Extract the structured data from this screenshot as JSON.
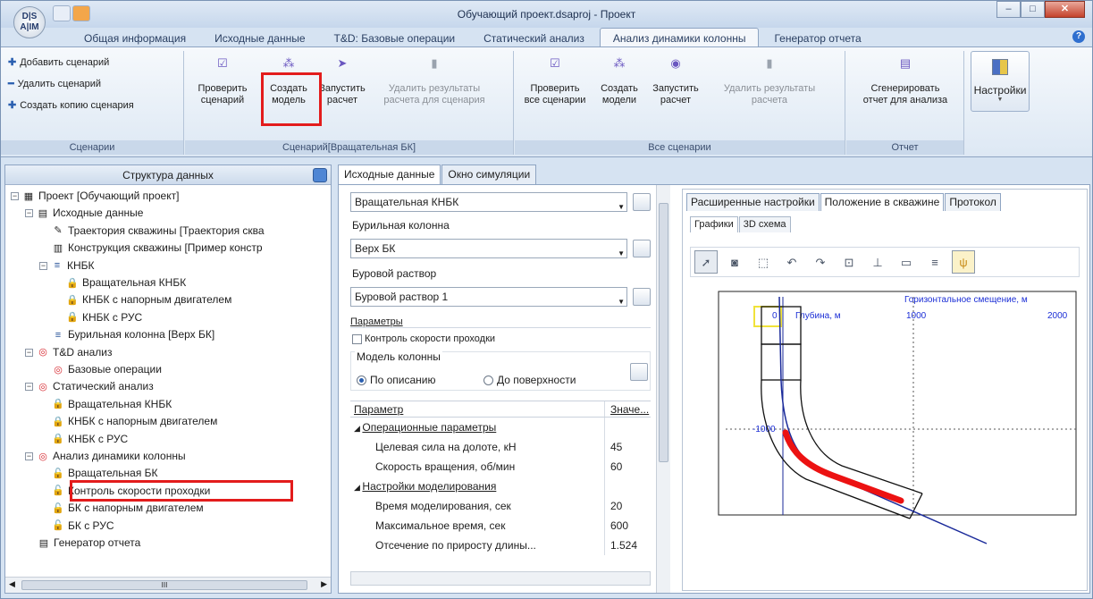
{
  "window": {
    "title": "Обучающий проект.dsaproj - Проект",
    "logo_text": "D|S A|IM"
  },
  "ribbon_tabs": [
    "Общая информация",
    "Исходные данные",
    "T&D: Базовые операции",
    "Статический анализ",
    "Анализ динамики колонны",
    "Генератор отчета"
  ],
  "active_ribbon_tab": 4,
  "ribbon": {
    "scenarios_group": {
      "label": "Сценарии",
      "add": "Добавить сценарий",
      "delete": "Удалить сценарий",
      "copy": "Создать копию сценария"
    },
    "scenario_group": {
      "label": "Сценарий[Вращательная БК]",
      "check": "Проверить сценарий",
      "check_l1": "Проверить",
      "check_l2": "сценарий",
      "create_l1": "Создать",
      "create_l2": "модель",
      "run_l1": "Запустить",
      "run_l2": "расчет",
      "del_l1": "Удалить результаты",
      "del_l2": "расчета для сценария"
    },
    "all_group": {
      "label": "Все сценарии",
      "check_l1": "Проверить",
      "check_l2": "все сценарии",
      "create_l1": "Создать",
      "create_l2": "модели",
      "run_l1": "Запустить",
      "run_l2": "расчет",
      "del_l1": "Удалить результаты",
      "del_l2": "расчета"
    },
    "report_group": {
      "label": "Отчет",
      "gen_l1": "Сгенерировать",
      "gen_l2": "отчет для анализа"
    },
    "settings_label": "Настройки"
  },
  "left_panel": {
    "title": "Структура данных",
    "tree": [
      {
        "label": "Проект [Обучающий проект]",
        "level": 0,
        "icon": "project-icon",
        "exp": "−"
      },
      {
        "label": "Исходные данные",
        "level": 1,
        "icon": "folder-icon",
        "exp": "−"
      },
      {
        "label": "Траектория скважины [Траектория сква",
        "level": 2,
        "icon": "trajectory-icon",
        "exp": ""
      },
      {
        "label": "Конструкция скважины [Пример констр",
        "level": 2,
        "icon": "construction-icon",
        "exp": ""
      },
      {
        "label": "КНБК",
        "level": 2,
        "icon": "bha-icon",
        "exp": "−"
      },
      {
        "label": "Вращательная КНБК",
        "level": 3,
        "icon": "lock-icon",
        "exp": ""
      },
      {
        "label": "КНБК с напорным двигателем",
        "level": 3,
        "icon": "lock-icon",
        "exp": ""
      },
      {
        "label": "КНБК с РУС",
        "level": 3,
        "icon": "lock-icon",
        "exp": ""
      },
      {
        "label": "Бурильная колонна [Верх БК]",
        "level": 2,
        "icon": "drillstring-icon",
        "exp": ""
      },
      {
        "label": "T&D анализ",
        "level": 1,
        "icon": "analysis-icon",
        "exp": "−"
      },
      {
        "label": "Базовые операции",
        "level": 2,
        "icon": "analysis-icon",
        "exp": ""
      },
      {
        "label": "Статический анализ",
        "level": 1,
        "icon": "analysis-icon",
        "exp": "−"
      },
      {
        "label": "Вращательная КНБК",
        "level": 2,
        "icon": "lock-icon",
        "exp": ""
      },
      {
        "label": "КНБК с напорным двигателем",
        "level": 2,
        "icon": "lock-icon",
        "exp": ""
      },
      {
        "label": "КНБК с РУС",
        "level": 2,
        "icon": "lock-icon",
        "exp": ""
      },
      {
        "label": "Анализ динамики колонны",
        "level": 1,
        "icon": "analysis-icon",
        "exp": "−"
      },
      {
        "label": "Вращательная БК",
        "level": 2,
        "icon": "unlock-icon",
        "exp": ""
      },
      {
        "label": "Контроль скорости проходки",
        "level": 2,
        "icon": "unlock-icon",
        "exp": ""
      },
      {
        "label": "БК с напорным двигателем",
        "level": 2,
        "icon": "unlock-icon",
        "exp": ""
      },
      {
        "label": "БК с РУС",
        "level": 2,
        "icon": "unlock-icon",
        "exp": ""
      },
      {
        "label": "Генератор отчета",
        "level": 1,
        "icon": "report-icon",
        "exp": ""
      }
    ]
  },
  "doc_tabs": [
    "Исходные данные",
    "Окно симуляции"
  ],
  "form": {
    "bha_value": "Вращательная КНБК",
    "drillstring_label": "Бурильная колонна",
    "drillstring_value": "Верх БК",
    "fluid_label": "Буровой раствор",
    "fluid_value": "Буровой раствор 1",
    "params_label": "Параметры",
    "rop_control": "Контроль скорости проходки",
    "model_label": "Модель колонны",
    "radio_desc": "По описанию",
    "radio_surface": "До поверхности",
    "col_param": "Параметр",
    "col_value": "Значе...",
    "rows": [
      {
        "name": "Операционные параметры",
        "value": "",
        "section": true
      },
      {
        "name": "Целевая сила на долоте, кН",
        "value": "45",
        "section": false
      },
      {
        "name": "Скорость вращения, об/мин",
        "value": "60",
        "section": false
      },
      {
        "name": "Настройки моделирования",
        "value": "",
        "section": true
      },
      {
        "name": "Время моделирования, сек",
        "value": "20",
        "section": false
      },
      {
        "name": "Максимальное время, сек",
        "value": "600",
        "section": false
      },
      {
        "name": "Отсечение по приросту длины...",
        "value": "1.524",
        "section": false
      }
    ]
  },
  "right_panel": {
    "tabs": [
      "Расширенные настройки",
      "Положение в скважине",
      "Протокол"
    ],
    "active_tab": 1,
    "subtabs": [
      "Графики",
      "3D схема"
    ],
    "chart": {
      "x_axis_label": "Горизонтальное смещение, м",
      "y_axis_label": "Глубина, м",
      "x_ticks": [
        "0",
        "1000",
        "2000"
      ],
      "y_tick": "-1000"
    }
  }
}
